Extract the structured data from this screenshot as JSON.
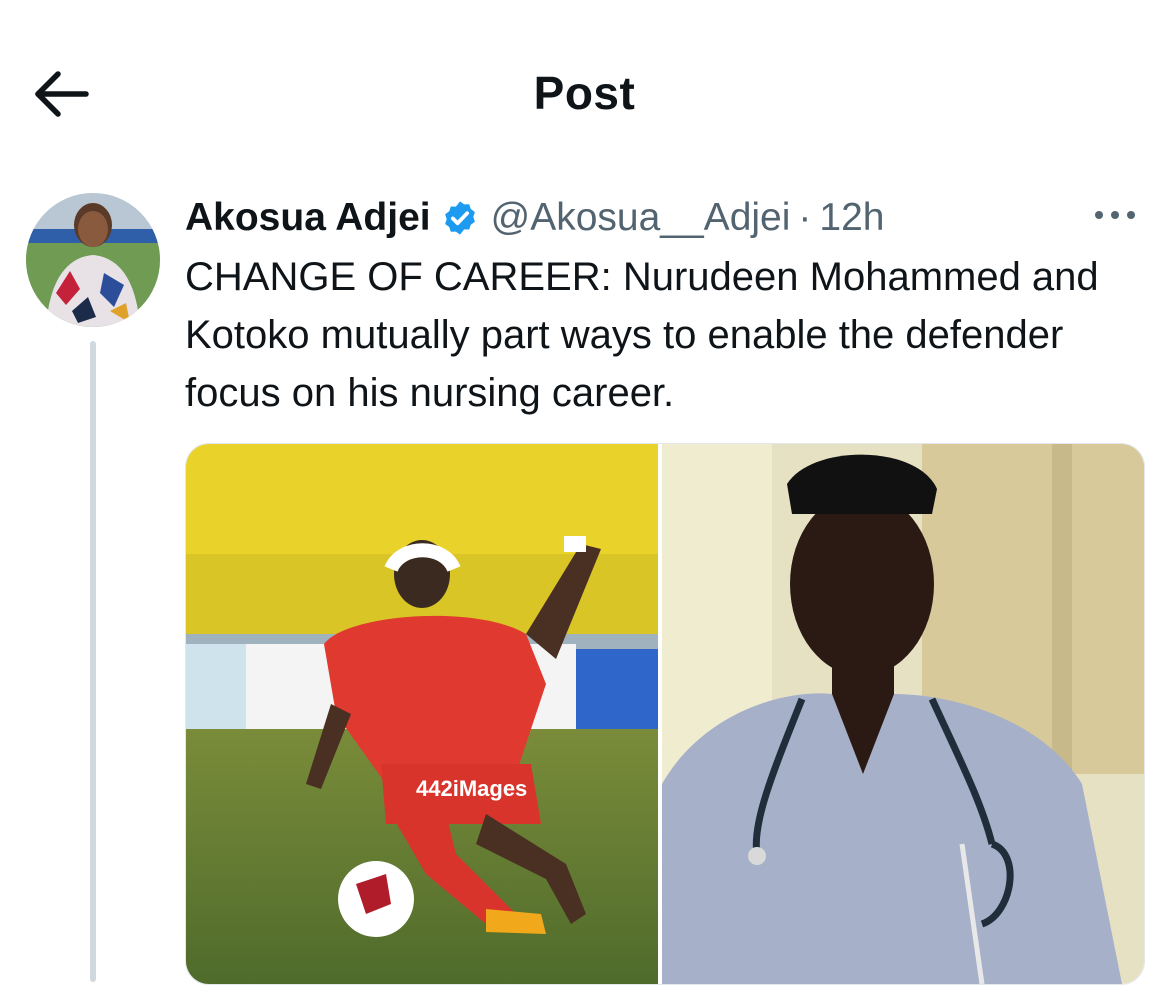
{
  "header": {
    "title": "Post",
    "back_icon": "arrow-left-icon"
  },
  "tweet": {
    "author_name": "Akosua Adjei",
    "verified_icon": "verified-badge-icon",
    "verified_color": "#1d9bf0",
    "handle": "@Akosua__Adjei",
    "separator": "·",
    "time": "12h",
    "more_icon": "more-options-icon",
    "text": "CHANGE OF CAREER: Nurudeen Mohammed and Kotoko mutually part ways to enable the defender focus on his nursing career.",
    "media": [
      {
        "description_icon": "football-player-photo",
        "watermark": "442iMages"
      },
      {
        "description_icon": "nurse-with-stethoscope-photo"
      }
    ]
  },
  "colors": {
    "text_primary": "#0f1419",
    "text_secondary": "#536471",
    "thread_line": "#cfd9de",
    "accent": "#1d9bf0"
  }
}
